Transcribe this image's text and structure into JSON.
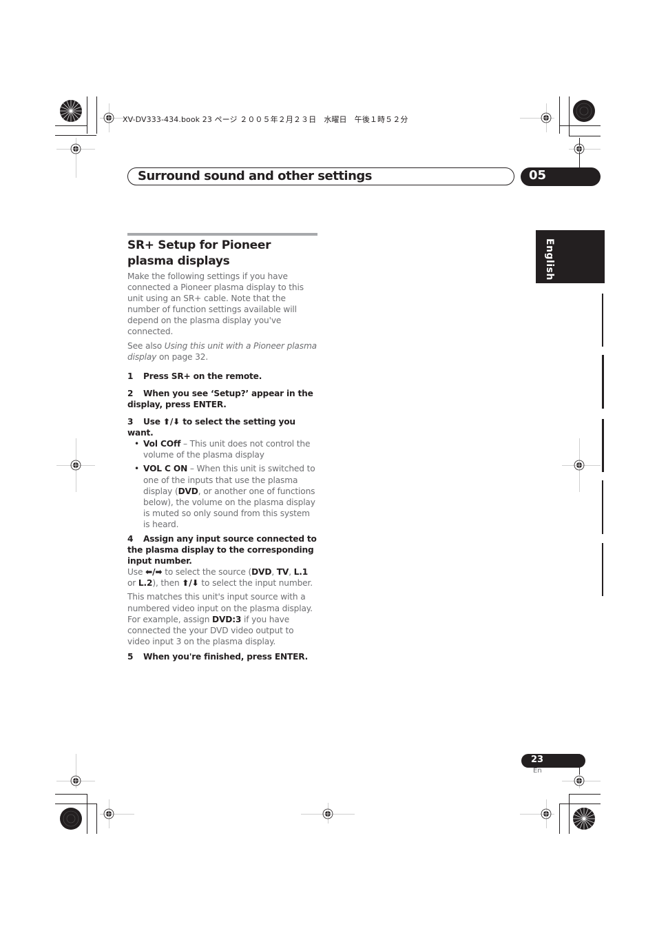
{
  "print_header": {
    "text": "XV-DV333-434.book  23 ページ  ２００５年２月２３日　水曜日　午後１時５２分"
  },
  "chapter": {
    "title": "Surround sound and other settings",
    "number": "05"
  },
  "language_tab": "English",
  "section": {
    "title": "SR+ Setup for Pioneer plasma displays",
    "intro": "Make the following settings if you have connected a Pioneer plasma display to this unit using an SR+ cable. Note that the number of function settings available will depend on the plasma display you've connected.",
    "see_also_prefix": "See also ",
    "see_also_link": "Using this unit with a Pioneer plasma display",
    "see_also_suffix": " on page 32."
  },
  "steps": [
    {
      "number": "1",
      "text": "Press SR+ on the remote."
    },
    {
      "number": "2",
      "text": "When you see ‘Setup?’ appear in the display, press ENTER."
    },
    {
      "number": "3",
      "text_pre": "Use ",
      "arrows": "⬆/⬇",
      "text_post": " to select the setting you want."
    },
    {
      "number": "4",
      "text": "Assign any input source connected to the plasma display to the corresponding input number."
    },
    {
      "number": "5",
      "text": "When you're finished, press ENTER."
    }
  ],
  "step3_options": [
    {
      "name": "Vol COff",
      "desc": " – This unit does not control the volume of the plasma display"
    },
    {
      "name": "VOL C ON",
      "desc_pre": " – When this unit is switched to one of the inputs that use the plasma display (",
      "desc_bold": "DVD",
      "desc_post": ", or another one of functions below), the volume on the plasma display is muted so only sound from this system is heard."
    }
  ],
  "step4_detail": {
    "p1_use": "Use ",
    "p1_lr_arrows": "⬅/➡",
    "p1_mid": " to select the source (",
    "src_dvd": "DVD",
    "sep1": ", ",
    "src_tv": "TV",
    "sep2": ", ",
    "src_l1": "L.1",
    "or": " or ",
    "src_l2": "L.2",
    "p1_then": "), then ",
    "p1_ud_arrows": "⬆/⬇",
    "p1_end": " to select the input number.",
    "p2_pre": "This matches this unit's input source with a numbered video input on the plasma display. For example, assign ",
    "p2_bold": "DVD:3",
    "p2_post": " if you have connected the your DVD video output to video input 3 on the plasma display."
  },
  "footer": {
    "page_number": "23",
    "page_lang": "En"
  }
}
